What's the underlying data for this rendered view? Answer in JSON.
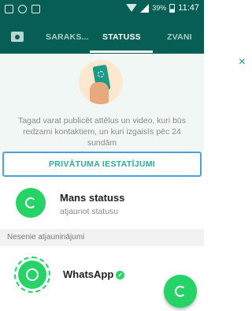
{
  "status_bar": {
    "battery_percent": "39%",
    "time": "11:47"
  },
  "tabs": [
    {
      "label": "SARAKS..."
    },
    {
      "label": "STATUSS"
    },
    {
      "label": "ZVANI"
    }
  ],
  "banner": {
    "text": "Tagad varat publicēt attēlus un video, kuri būs redzami kontaktiem, un kuri izgaisīs pēc 24 sundām",
    "button_label": "PRIVĀTUMA IESTATĪJUMI",
    "close_symbol": "×"
  },
  "my_status": {
    "title": "Mans statuss",
    "subtitle": "atjaunot statusu"
  },
  "section_header": "Nesenie atjauninājumi",
  "recent": [
    {
      "name": "WhatsApp",
      "verified_symbol": "✓"
    }
  ],
  "colors": {
    "primary": "#075e54",
    "accent": "#25d366",
    "banner_bg": "#f0f7f5"
  }
}
